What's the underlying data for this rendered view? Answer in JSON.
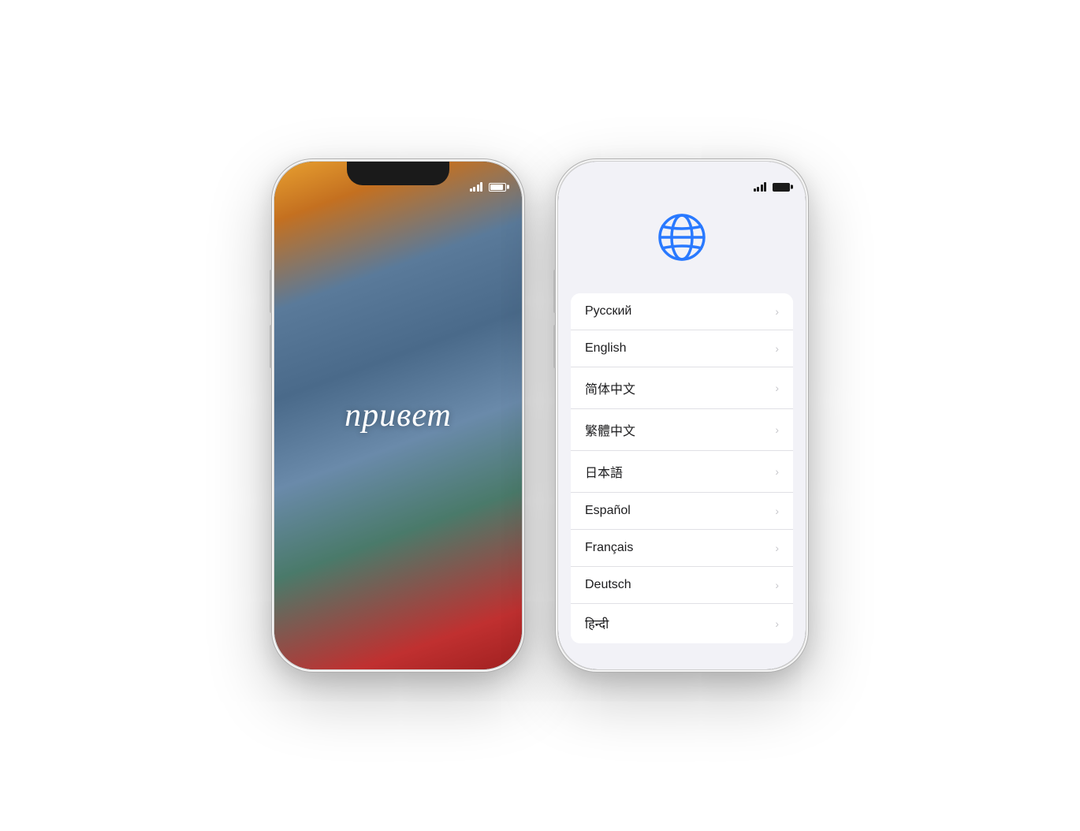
{
  "phone1": {
    "greeting": "привет",
    "statusIcons": {
      "signal": "signal-icon",
      "battery": "battery-icon"
    }
  },
  "phone2": {
    "globe": "globe-icon",
    "languages": [
      {
        "label": "Русский"
      },
      {
        "label": "English"
      },
      {
        "label": "简体中文"
      },
      {
        "label": "繁體中文"
      },
      {
        "label": "日本語"
      },
      {
        "label": "Español"
      },
      {
        "label": "Français"
      },
      {
        "label": "Deutsch"
      },
      {
        "label": "हिन्दी"
      }
    ]
  }
}
